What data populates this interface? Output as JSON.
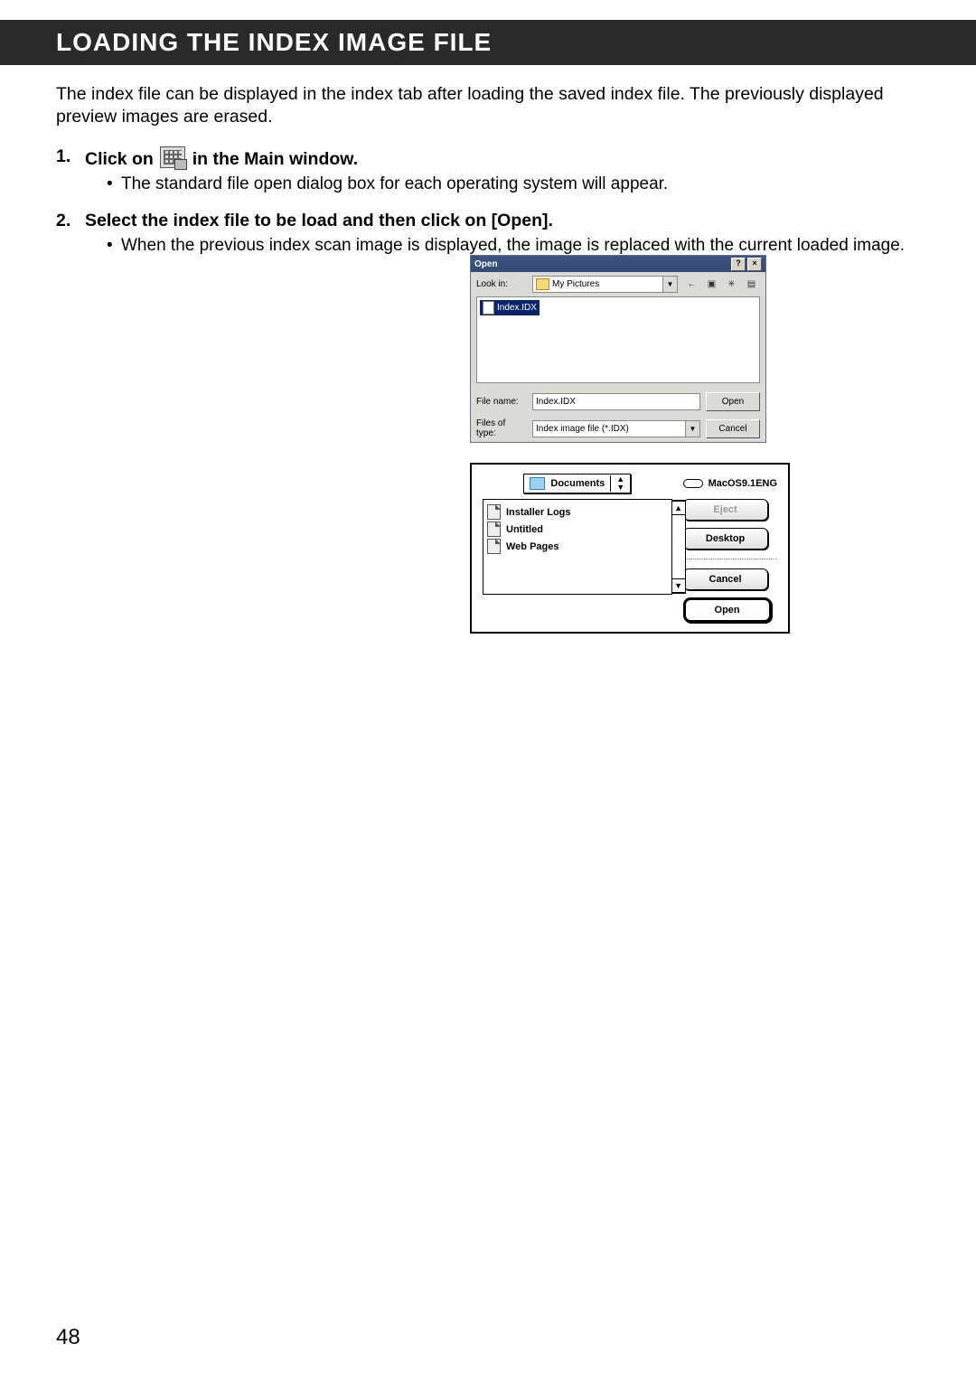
{
  "header": {
    "title": "LOADING THE INDEX IMAGE FILE"
  },
  "intro": "The index file can be displayed in the index tab after loading the saved index file. The previously displayed preview images are erased.",
  "steps": [
    {
      "num": "1.",
      "text_before": "Click on ",
      "text_after": " in the Main window.",
      "bullets": [
        "The standard file open dialog box for each operating system will appear."
      ]
    },
    {
      "num": "2.",
      "text": "Select the index file to be load and then click on [Open].",
      "bullets": [
        "When the previous index scan image is displayed, the image is replaced with the current loaded image."
      ]
    }
  ],
  "win_dialog": {
    "title": "Open",
    "help_btn": "?",
    "close_btn": "×",
    "look_in_label": "Look in:",
    "look_in_value": "My Pictures",
    "back_icon": "←",
    "up_icon": "▣",
    "newfolder_icon": "✳",
    "views_icon": "▤",
    "selected_file": "Index.IDX",
    "file_name_label": "File name:",
    "file_name_value": "Index.IDX",
    "files_of_type_label": "Files of type:",
    "files_of_type_value": "Index image file (*.IDX)",
    "open_btn": "Open",
    "cancel_btn": "Cancel"
  },
  "mac_dialog": {
    "folder": "Documents",
    "disk": "MacOS9.1ENG",
    "items": [
      "Installer Logs",
      "Untitled",
      "Web Pages"
    ],
    "eject_btn": "Eject",
    "desktop_btn": "Desktop",
    "cancel_btn": "Cancel",
    "open_btn": "Open",
    "up": "▲",
    "down": "▼"
  },
  "page_number": "48"
}
